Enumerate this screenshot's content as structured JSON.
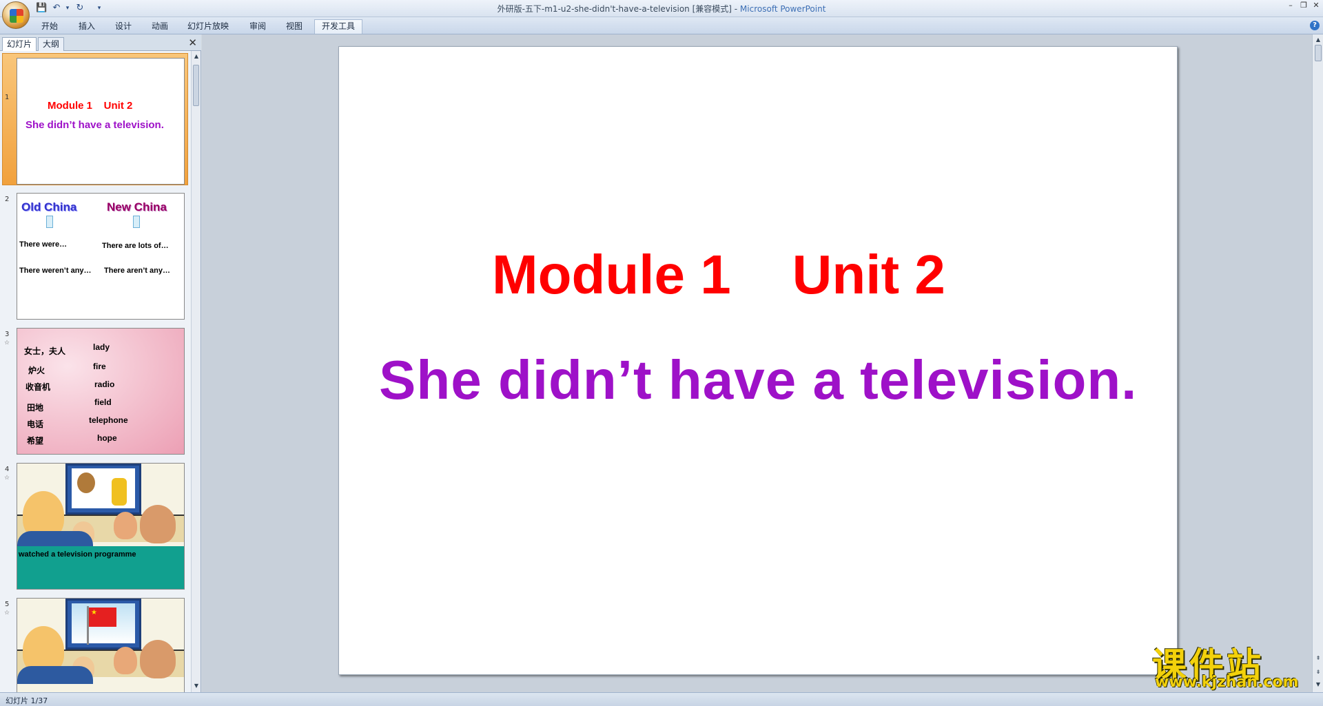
{
  "window": {
    "title_doc": "外研版-五下-m1-u2-she-didn't-have-a-television [兼容模式] - ",
    "title_app": "Microsoft PowerPoint",
    "min": "–",
    "max": "❐",
    "close": "✕"
  },
  "qat": {
    "save": "💾",
    "undo": "↶",
    "redo": "↻",
    "more": "▾"
  },
  "ribbon": {
    "tabs": [
      "开始",
      "插入",
      "设计",
      "动画",
      "幻灯片放映",
      "审阅",
      "视图",
      "开发工具"
    ],
    "help": "?"
  },
  "pane": {
    "tab_slides": "幻灯片",
    "tab_outline": "大纲",
    "close": "✕"
  },
  "thumbnails": [
    {
      "num": "1",
      "title": "Module 1    Unit 2",
      "subtitle": "She didn’t have a television."
    },
    {
      "num": "2",
      "left_head": "Old China",
      "right_head": "New China",
      "left_1": "There were…",
      "right_1": "There are lots  of…",
      "left_2": "There weren’t any…",
      "right_2": "There aren’t any…"
    },
    {
      "num": "3",
      "star": "☆",
      "cn": [
        "女士，夫人",
        "炉火",
        "收音机",
        "田地",
        "电话",
        "希望"
      ],
      "en": [
        "lady",
        "fire",
        "radio",
        "field",
        "telephone",
        "hope"
      ]
    },
    {
      "num": "4",
      "star": "☆",
      "caption": "watched a television programme"
    },
    {
      "num": "5",
      "star": "☆"
    }
  ],
  "slide": {
    "title": "Module 1    Unit 2",
    "subtitle": "She didn’t have a television."
  },
  "colors": {
    "title": "#ff0000",
    "subtitle": "#9e11c8",
    "thumb_subtitle": "#9e11c8"
  },
  "watermark": {
    "cn": "课件站",
    "url": "www.kjzhan.com"
  },
  "status": {
    "text": "幻灯片 1/37"
  }
}
